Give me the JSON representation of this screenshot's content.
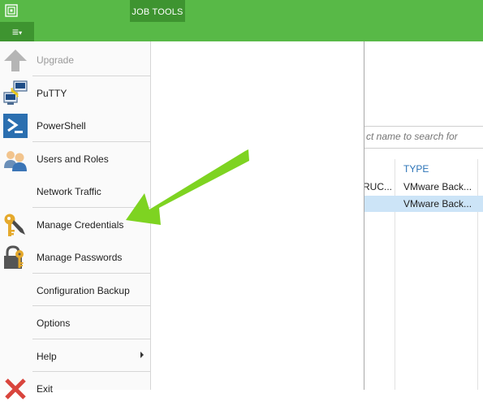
{
  "ribbon": {
    "tab_job_tools": "JOB TOOLS",
    "menu_button_glyph": "≡",
    "menu_button_chevron": "▾"
  },
  "menu": {
    "items": [
      {
        "label": "Upgrade",
        "icon": "upgrade-arrow-icon",
        "disabled": true
      },
      {
        "label": "PuTTY",
        "icon": "putty-icon"
      },
      {
        "label": "PowerShell",
        "icon": "powershell-icon"
      },
      {
        "label": "Users and Roles",
        "icon": "users-icon"
      },
      {
        "label": "Network Traffic",
        "icon": ""
      },
      {
        "label": "Manage Credentials",
        "icon": "key-icon"
      },
      {
        "label": "Manage Passwords",
        "icon": "lock-key-icon"
      },
      {
        "label": "Configuration Backup",
        "icon": ""
      },
      {
        "label": "Options",
        "icon": ""
      },
      {
        "label": "Help",
        "icon": "",
        "submenu": true
      },
      {
        "label": "Exit",
        "icon": "exit-x-icon"
      }
    ]
  },
  "search": {
    "placeholder": "ct name to search for"
  },
  "table": {
    "columns": [
      "",
      "TYPE"
    ],
    "rows": [
      {
        "name": "RUC...",
        "type": "VMware Back..."
      },
      {
        "name": "",
        "type": "VMware Back...",
        "selected": true
      }
    ]
  },
  "colors": {
    "accent_green": "#58b947",
    "dark_green": "#3e9430",
    "header_blue": "#2b73b7",
    "selection_blue": "#cce4f7",
    "callout_arrow": "#7ed321"
  }
}
